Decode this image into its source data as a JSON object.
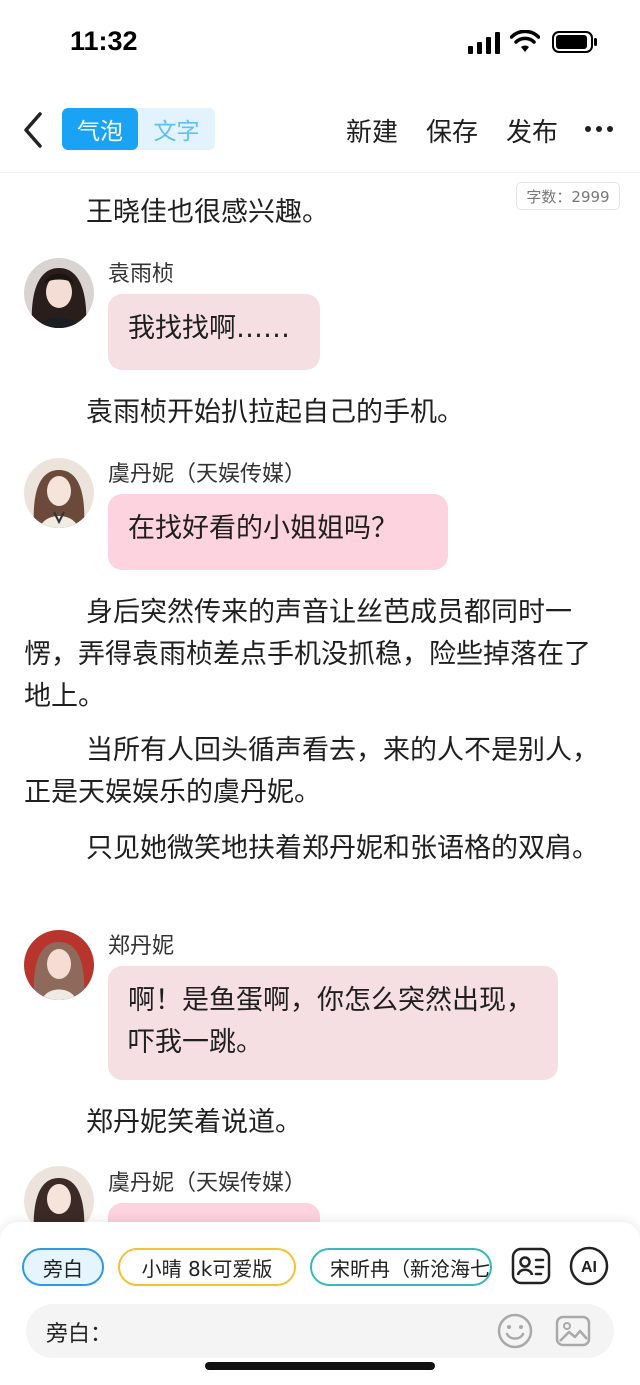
{
  "status_bar": {
    "time": "11:32"
  },
  "toolbar": {
    "mode_bubble": "气泡",
    "mode_text": "文字",
    "new_label": "新建",
    "save_label": "保存",
    "publish_label": "发布"
  },
  "word_count": "字数：2999",
  "story": {
    "p1": "王晓佳也很感兴趣。",
    "msg1_name": "袁雨桢",
    "msg1_text": "我找找啊……",
    "p2": "袁雨桢开始扒拉起自己的手机。",
    "msg2_name": "虞丹妮（天娱传媒）",
    "msg2_text": "在找好看的小姐姐吗？",
    "p3": "身后突然传来的声音让丝芭成员都同时一愣，弄得袁雨桢差点手机没抓稳，险些掉落在了地上。",
    "p4": "当所有人回头循声看去，来的人不是别人，正是天娱娱乐的虞丹妮。",
    "p5": "只见她微笑地扶着郑丹妮和张语格的双肩。",
    "msg3_name": "郑丹妮",
    "msg3_text": "啊！是鱼蛋啊，你怎么突然出现，吓我一跳。",
    "p6": "郑丹妮笑着说道。",
    "msg4_name": "虞丹妮（天娱传媒）"
  },
  "roles": {
    "narrator": "旁白",
    "role2": "小晴 8k可爱版",
    "role3": "宋昕冉（新沧海七"
  },
  "input": {
    "label": "旁白："
  },
  "colors": {
    "accent": "#1aa3f5",
    "bubble_default": "#f6dfe2",
    "bubble_pink": "#fdd3df"
  },
  "icons": [
    "back-icon",
    "more-icon",
    "contact-card-icon",
    "ai-icon",
    "emoji-icon",
    "image-icon"
  ]
}
